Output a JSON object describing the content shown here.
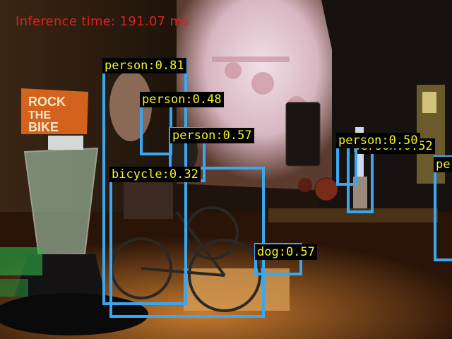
{
  "inference_text": "Inference time: 191.07 ms",
  "scene": {
    "banner_text_1": "ROCK",
    "banner_text_2": "THE",
    "banner_text_3": "BIKE"
  },
  "detections": [
    {
      "label": "person:0.81"
    },
    {
      "label": "person:0.48"
    },
    {
      "label": "person:0.57"
    },
    {
      "label": "bicycle:0.32"
    },
    {
      "label": "dog:0.57"
    },
    {
      "label": "person:0.50"
    },
    {
      "label": "person:0.52"
    },
    {
      "label": "pe"
    }
  ],
  "colors": {
    "box": "#3aa8f0",
    "label_text": "#f5f52a",
    "overlay_text": "#e02020"
  }
}
